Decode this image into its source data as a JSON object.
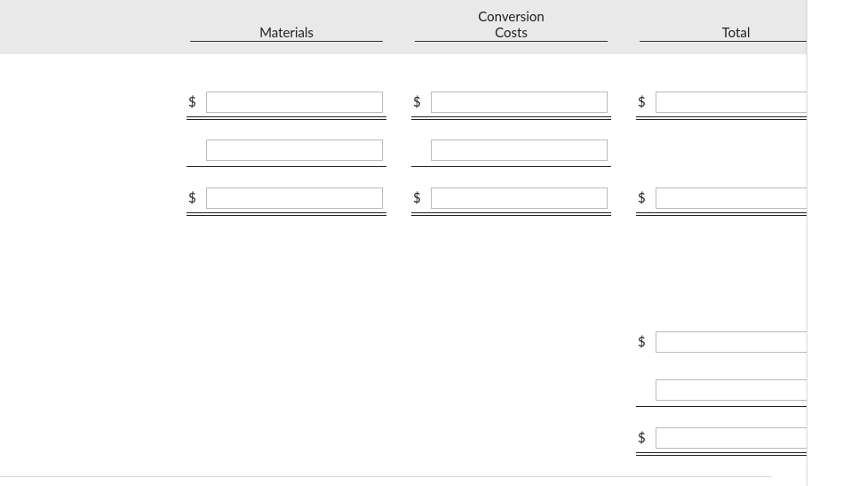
{
  "currency_symbol": "$",
  "columns": {
    "materials": {
      "label": "Materials"
    },
    "conversion": {
      "label_line1": "Conversion",
      "label_line2": "Costs"
    },
    "total": {
      "label": "Total"
    }
  },
  "rows": [
    {
      "materials": {
        "dollar": true,
        "value": "",
        "underline": "double"
      },
      "conversion": {
        "dollar": true,
        "value": "",
        "underline": "double"
      },
      "total": {
        "dollar": true,
        "value": "",
        "underline": "double"
      }
    },
    {
      "materials": {
        "dollar": false,
        "value": "",
        "underline": "single"
      },
      "conversion": {
        "dollar": false,
        "value": "",
        "underline": "single"
      },
      "total": null
    },
    {
      "materials": {
        "dollar": true,
        "value": "",
        "underline": "double"
      },
      "conversion": {
        "dollar": true,
        "value": "",
        "underline": "double"
      },
      "total": {
        "dollar": true,
        "value": "",
        "underline": "double"
      }
    },
    {
      "materials": null,
      "conversion": null,
      "total": null
    },
    {
      "materials": null,
      "conversion": null,
      "total": null
    },
    {
      "materials": null,
      "conversion": null,
      "total": {
        "dollar": true,
        "value": "",
        "underline": "none"
      }
    },
    {
      "materials": null,
      "conversion": null,
      "total": {
        "dollar": false,
        "value": "",
        "underline": "single"
      }
    },
    {
      "materials": null,
      "conversion": null,
      "total": {
        "dollar": true,
        "value": "",
        "underline": "double"
      }
    }
  ]
}
